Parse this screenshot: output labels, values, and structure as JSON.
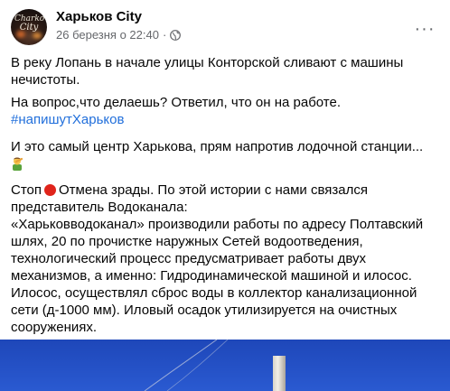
{
  "post": {
    "author": "Харьков City",
    "timestamp": "26 березня о 22:40",
    "separator": "·",
    "privacy_icon": "globe-icon",
    "more_icon": "more-options-icon",
    "more_label": "···",
    "avatar_text_line1": "Charko",
    "avatar_text_line2": "City",
    "paragraphs": {
      "p1_line1": "В реку Лопань в начале улицы Конторской сливают с машины",
      "p1_line2": "нечистоты.",
      "p2": "На вопрос,что делаешь? Ответил, что он на работе.",
      "hashtag": "#напишутХарьков",
      "p3": "И это самый центр Харькова, прям напротив лодочной станции...",
      "emoji": "man-facepalming-emoji",
      "p4_prefix": "Стоп",
      "p4_dot": "red-circle-emoji",
      "p4_line1_rest": "Отмена зрады. По этой истории с нами связался",
      "p4_line2": "представитель Водоканала:",
      "p4_line3": "«Харьковводоканал» производили работы по адресу Полтавский",
      "p4_line4": "шлях, 20 по прочистке наружных Сетей водоотведения,",
      "p4_line5": "технологический процесс предусматривает работы двух",
      "p4_line6": "механизмов, а именно: Гидродинамической машиной и илосос.",
      "p4_line7": "Илосос, осуществлял сброс воды в коллектор канализационной",
      "p4_line8": "сети (д-1000 мм). Иловый осадок утилизируется на очистных",
      "p4_line9": "сооружениях."
    }
  },
  "colors": {
    "hashtag": "#216fdb",
    "meta": "#65676b",
    "photo_sky": "#1e47b9"
  }
}
